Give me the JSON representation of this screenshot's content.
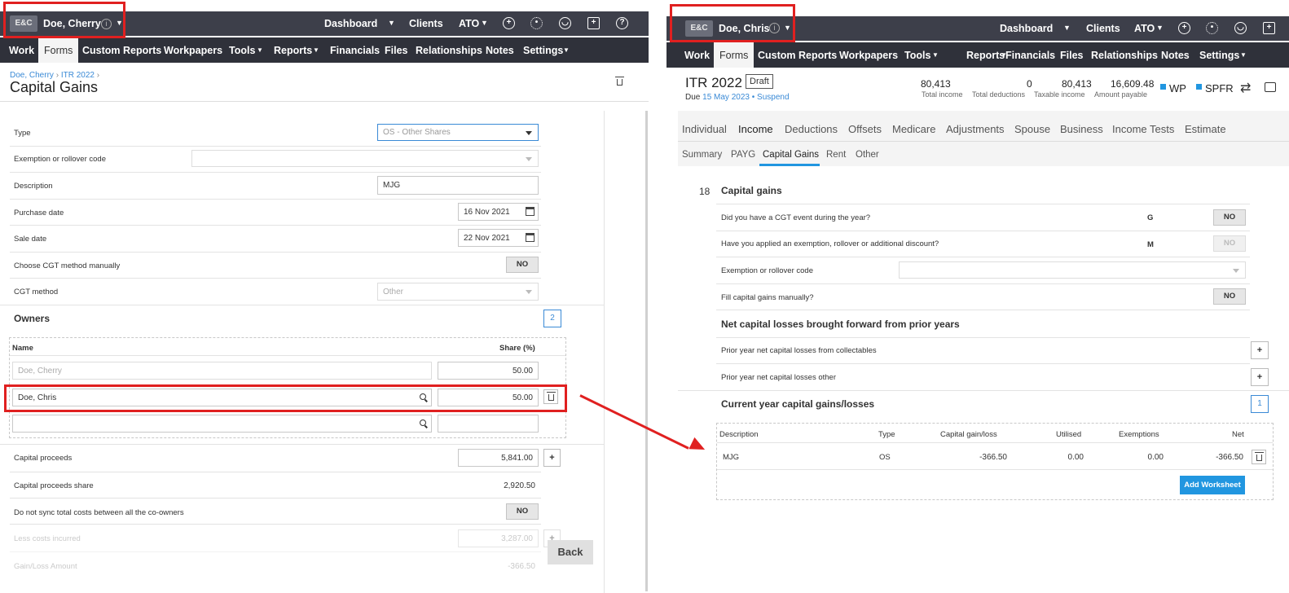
{
  "left": {
    "topbar": {
      "badge": "E&C",
      "client": "Doe, Cherry",
      "info_icon": "i",
      "dashboard": "Dashboard",
      "clients": "Clients",
      "ato": "ATO",
      "icons": [
        "plus-icon",
        "gear-icon",
        "user-icon",
        "gift-icon",
        "help-icon"
      ]
    },
    "nav": [
      "Work",
      "Forms",
      "Custom Reports",
      "Workpapers",
      "Tools",
      "Reports",
      "Financials",
      "Files",
      "Relationships",
      "Notes",
      "Settings"
    ],
    "breadcrumb": {
      "client": "Doe, Cherry",
      "sep1": "›",
      "form": "ITR 2022",
      "sep2": "›"
    },
    "page_title": "Capital Gains",
    "form": {
      "type_label": "Type",
      "type_value": "OS - Other Shares",
      "exemption_label": "Exemption or rollover code",
      "exemption_value": "",
      "description_label": "Description",
      "description_value": "MJG",
      "purchase_label": "Purchase date",
      "purchase_value": "16 Nov 2021",
      "sale_label": "Sale date",
      "sale_value": "22 Nov 2021",
      "cgt_manual_label": "Choose CGT method manually",
      "cgt_manual_value": "NO",
      "cgt_method_label": "CGT method",
      "cgt_method_value": "Other",
      "owners_heading": "Owners",
      "owners_count": "2",
      "owners_col_name": "Name",
      "owners_col_share": "Share (%)",
      "owners": [
        {
          "name": "Doe, Cherry",
          "share": "50.00"
        },
        {
          "name": "Doe, Chris",
          "share": "50.00"
        },
        {
          "name": "",
          "share": ""
        }
      ],
      "proceeds_label": "Capital proceeds",
      "proceeds_value": "5,841.00",
      "plus": "+",
      "proceeds_share_label": "Capital proceeds share",
      "proceeds_share_value": "2,920.50",
      "nosync_label": "Do not sync total costs between all the co-owners",
      "nosync_value": "NO",
      "costs_label": "Less costs incurred",
      "costs_value": "3,287.00",
      "gainloss_label": "Gain/Loss Amount",
      "gainloss_value": "-366.50"
    },
    "back_button": "Back"
  },
  "right": {
    "topbar": {
      "badge": "E&C",
      "client": "Doe, Chris",
      "info_icon": "i",
      "dashboard": "Dashboard",
      "clients": "Clients",
      "ato": "ATO",
      "icons": [
        "plus-icon",
        "gear-icon",
        "user-icon",
        "gift-icon"
      ]
    },
    "nav": [
      "Work",
      "Forms",
      "Custom Reports",
      "Workpapers",
      "Tools",
      "Reports",
      "Financials",
      "Files",
      "Relationships",
      "Notes",
      "Settings"
    ],
    "header": {
      "title": "ITR 2022",
      "status": "Draft",
      "due_prefix": "Due",
      "due_date": "15 May 2023",
      "suspend": "• Suspend",
      "stats": [
        {
          "value": "80,413",
          "label": "Total income"
        },
        {
          "value": "0",
          "label": "Total deductions"
        },
        {
          "value": "80,413",
          "label": "Taxable income"
        },
        {
          "value": "16,609.48",
          "label": "Amount payable"
        }
      ],
      "wp": "WP",
      "spfr": "SPFR"
    },
    "tabs": [
      "Individual",
      "Income",
      "Deductions",
      "Offsets",
      "Medicare",
      "Adjustments",
      "Spouse",
      "Business",
      "Income Tests",
      "Estimate"
    ],
    "subtabs": [
      "Summary",
      "PAYG",
      "Capital Gains",
      "Rent",
      "Other"
    ],
    "section": {
      "number": "18",
      "heading": "Capital gains",
      "q1": "Did you have a CGT event during the year?",
      "q1_code": "G",
      "q1_value": "NO",
      "q2": "Have you applied an exemption, rollover or additional discount?",
      "q2_code": "M",
      "q2_value": "NO",
      "q3": "Exemption or rollover code",
      "q4": "Fill capital gains manually?",
      "q4_value": "NO",
      "losses_heading": "Net capital losses brought forward from prior years",
      "loss1": "Prior year net capital losses from collectables",
      "loss2": "Prior year net capital losses other",
      "plus": "+",
      "current_heading": "Current year capital gains/losses",
      "current_count": "1",
      "columns": [
        "Description",
        "Type",
        "Capital gain/loss",
        "Utilised",
        "Exemptions",
        "Net"
      ],
      "rows": [
        [
          "MJG",
          "OS",
          "-366.50",
          "0.00",
          "0.00",
          "-366.50"
        ]
      ],
      "add_worksheet": "Add Worksheet"
    }
  },
  "colors": {
    "topbar": "#3d3f4a",
    "nav": "#2f313a",
    "accent": "#2196e0",
    "highlight": "#e02020"
  }
}
